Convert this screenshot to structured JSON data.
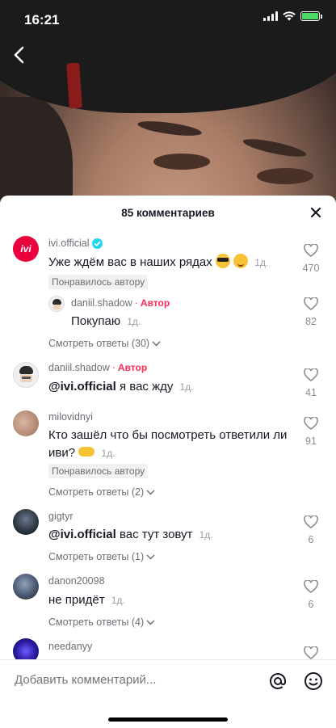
{
  "status_bar": {
    "time": "16:21"
  },
  "sheet": {
    "title": "85 комментариев"
  },
  "comments": [
    {
      "username": "ivi.official",
      "verified": true,
      "text": "Уже ждём вас в наших рядах",
      "date": "1д.",
      "likes": "470",
      "liked_by_author": "Понравилось автору",
      "reply": {
        "username": "daniil.shadow",
        "author_label": "Автор",
        "text": "Покупаю",
        "date": "1д.",
        "likes": "82"
      },
      "view_replies": "Смотреть ответы (30)"
    },
    {
      "username": "daniil.shadow",
      "author_label": "Автор",
      "mention": "@ivi.official",
      "text": "я вас жду",
      "date": "1д.",
      "likes": "41"
    },
    {
      "username": "milovidnyi",
      "text_line1": "Кто зашёл что бы посмотреть ответили ли",
      "text_line2": "иви?",
      "date": "1д.",
      "likes": "91",
      "liked_by_author": "Понравилось автору",
      "view_replies": "Смотреть ответы (2)"
    },
    {
      "username": "gigtyr",
      "mention": "@ivi.official",
      "text": "вас тут зовут",
      "date": "1д.",
      "likes": "6",
      "view_replies": "Смотреть ответы (1)"
    },
    {
      "username": "danon20098",
      "text": "не придёт",
      "date": "1д.",
      "likes": "6",
      "view_replies": "Смотреть ответы (4)"
    },
    {
      "username": "needanyy"
    }
  ],
  "avatar_logo_text": "ivi",
  "composer": {
    "placeholder": "Добавить комментарий..."
  },
  "colors": {
    "accent": "#fe2c55",
    "verified": "#20d5ec",
    "ivi_brand": "#ea003d"
  },
  "icons": [
    "back-arrow-icon",
    "close-icon",
    "heart-icon",
    "verified-icon",
    "chevron-down-icon",
    "at-icon",
    "emoji-icon"
  ]
}
